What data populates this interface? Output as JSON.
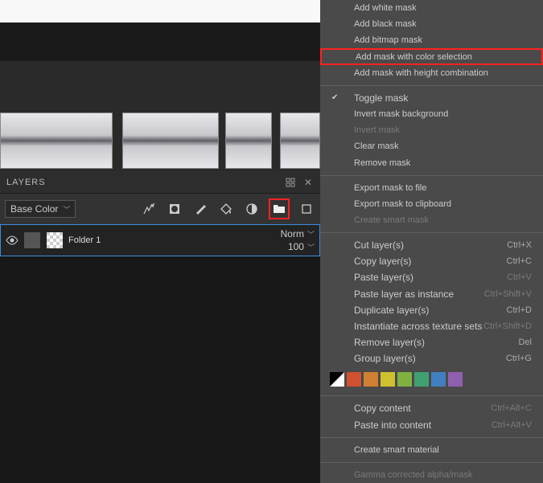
{
  "canvas": {},
  "layers": {
    "title": "LAYERS",
    "dropdown": "Base Color",
    "layer": {
      "name": "Folder 1",
      "blend": "Norm",
      "opacity": "100"
    }
  },
  "menu": {
    "add_white": "Add white mask",
    "add_black": "Add black mask",
    "add_bitmap": "Add bitmap mask",
    "add_color_sel": "Add mask with color selection",
    "add_height": "Add mask with height combination",
    "toggle": "Toggle mask",
    "invert_bg": "Invert mask background",
    "invert": "Invert mask",
    "clear": "Clear mask",
    "remove": "Remove mask",
    "export_file": "Export mask to file",
    "export_clip": "Export mask to clipboard",
    "create_smart_mask": "Create smart mask",
    "cut": "Cut layer(s)",
    "copy": "Copy layer(s)",
    "paste": "Paste layer(s)",
    "paste_inst": "Paste layer as instance",
    "dup": "Duplicate layer(s)",
    "inst_across": "Instantiate across texture sets",
    "remove_layer": "Remove layer(s)",
    "group": "Group layer(s)",
    "copy_content": "Copy content",
    "paste_content": "Paste into content",
    "create_material": "Create smart material",
    "gamma": "Gamma corrected alpha/mask"
  },
  "shortcut": {
    "cut": "Ctrl+X",
    "copy": "Ctrl+C",
    "paste": "Ctrl+V",
    "paste_inst": "Ctrl+Shift+V",
    "dup": "Ctrl+D",
    "inst_across": "Ctrl+Shift+D",
    "remove": "Del",
    "group": "Ctrl+G",
    "copy_content": "Ctrl+Alt+C",
    "paste_content": "Ctrl+Alt+V"
  },
  "swatches": [
    "#d05030",
    "#d08030",
    "#d0c030",
    "#80b040",
    "#40a070",
    "#4080c0",
    "#9060b0"
  ]
}
